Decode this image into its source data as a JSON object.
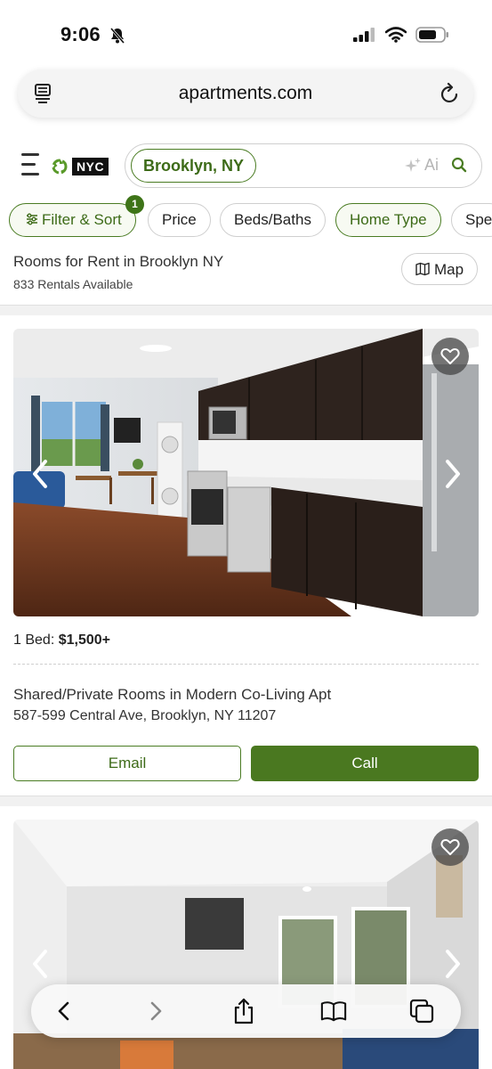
{
  "status_bar": {
    "time": "9:06",
    "icons": [
      "bell-slash-icon",
      "cellular-signal-icon",
      "wifi-icon",
      "battery-icon"
    ]
  },
  "browser": {
    "url": "apartments.com",
    "icons": [
      "reader-icon",
      "reload-icon"
    ]
  },
  "header": {
    "logo_text": "NYC",
    "search": {
      "chip_label": "Brooklyn, NY",
      "ai_label": "Ai"
    }
  },
  "filters": {
    "items": [
      {
        "label": "Filter & Sort",
        "active": true
      },
      {
        "label": "Price",
        "active": false
      },
      {
        "label": "Beds/Baths",
        "active": false
      },
      {
        "label": "Home Type",
        "active": true
      },
      {
        "label": "Spe",
        "active": false
      }
    ],
    "filter_count": "1"
  },
  "results": {
    "title": "Rooms for Rent in Brooklyn NY",
    "count": "833 Rentals Available",
    "map_label": "Map"
  },
  "listings": [
    {
      "price_prefix": "1 Bed:",
      "price": "$1,500+",
      "title": "Shared/Private Rooms in Modern Co-Living Apt",
      "address": "587-599 Central Ave, Brooklyn, NY 11207",
      "email_label": "Email",
      "call_label": "Call"
    }
  ],
  "toolbar": {
    "icons": [
      "back-icon",
      "forward-icon",
      "share-icon",
      "bookmarks-icon",
      "tabs-icon"
    ]
  },
  "colors": {
    "brand_green": "#4a7820",
    "brand_green_text": "#3d6b18"
  }
}
